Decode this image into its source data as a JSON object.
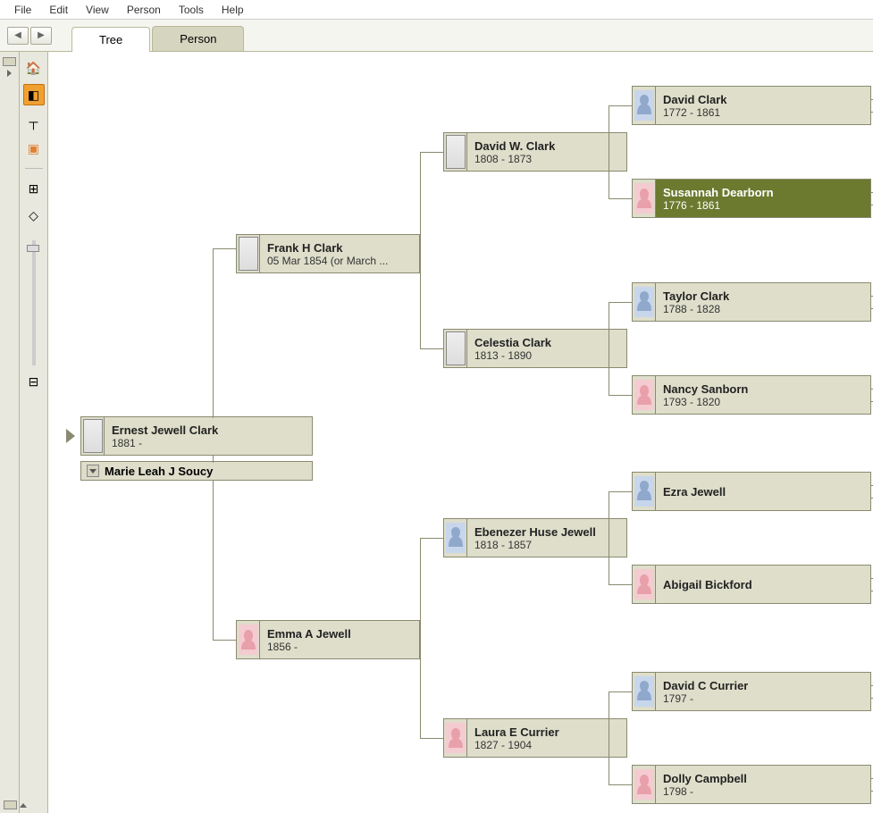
{
  "menu": {
    "file": "File",
    "edit": "Edit",
    "view": "View",
    "person": "Person",
    "tools": "Tools",
    "help": "Help"
  },
  "tabs": {
    "tree": "Tree",
    "person": "Person"
  },
  "people": {
    "root": {
      "name": "Ernest Jewell Clark",
      "dates": "1881 -"
    },
    "spouse": {
      "name": "Marie Leah J Soucy"
    },
    "f": {
      "name": "Frank H Clark",
      "dates": "05 Mar 1854 (or March ..."
    },
    "m": {
      "name": "Emma A Jewell",
      "dates": "1856 -"
    },
    "ff": {
      "name": "David W. Clark",
      "dates": "1808 - 1873"
    },
    "fm": {
      "name": "Celestia Clark",
      "dates": "1813 - 1890"
    },
    "mf": {
      "name": "Ebenezer Huse Jewell",
      "dates": "1818 - 1857"
    },
    "mm": {
      "name": "Laura E Currier",
      "dates": "1827 - 1904"
    },
    "fff": {
      "name": "David Clark",
      "dates": "1772 - 1861"
    },
    "ffm": {
      "name": "Susannah Dearborn",
      "dates": "1776 - 1861"
    },
    "fmf": {
      "name": "Taylor Clark",
      "dates": "1788 - 1828"
    },
    "fmm": {
      "name": "Nancy Sanborn",
      "dates": "1793 - 1820"
    },
    "mff": {
      "name": "Ezra Jewell",
      "dates": ""
    },
    "mfm": {
      "name": "Abigail Bickford",
      "dates": ""
    },
    "mmf": {
      "name": "David C Currier",
      "dates": "1797 -"
    },
    "mmm": {
      "name": "Dolly Campbell",
      "dates": "1798 -"
    }
  }
}
